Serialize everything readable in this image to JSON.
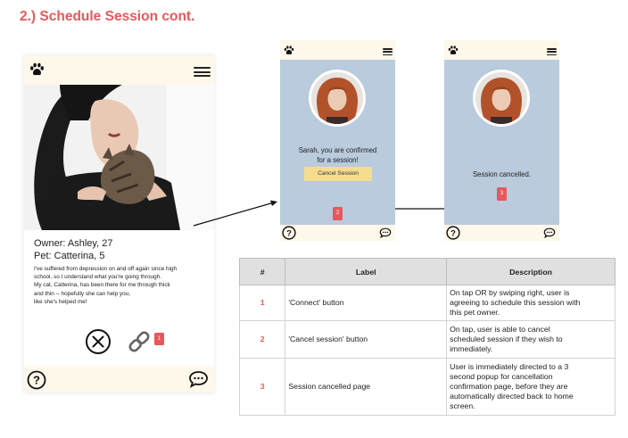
{
  "title": "2.) Schedule Session cont.",
  "screen1": {
    "owner": "Owner: Ashley, 27",
    "pet": "Pet: Catterina, 5",
    "bio_lines": [
      "I've suffered from depression on and off again since high",
      "school, so I understand what you're going through.",
      "My cat, Catterina, has been there for me through thick",
      "and thin -- hopefully she can help you,",
      "like she's helped me!"
    ],
    "badge": "1"
  },
  "screen2": {
    "message_line1": "Sarah, you are confirmed",
    "message_line2": "for a session!",
    "cancel_button": "Cancel Session",
    "badge": "2"
  },
  "screen3": {
    "message": "Session cancelled.",
    "badge": "3"
  },
  "table": {
    "headers": [
      "#",
      "Label",
      "Description"
    ],
    "rows": [
      {
        "num": "1",
        "label": "'Connect' button",
        "desc": [
          "On tap OR by swiping right, user is",
          "agreeing to schedule this session with",
          "this pet owner."
        ]
      },
      {
        "num": "2",
        "label": "'Cancel session' button",
        "desc": [
          "On tap, user is able to cancel",
          "scheduled session if they wish to",
          "immediately."
        ]
      },
      {
        "num": "3",
        "label": "Session cancelled page",
        "desc": [
          "User is immediately directed to a 3",
          "second popup for cancellation",
          "confirmation page, before they are",
          "automatically directed back to home",
          "screen."
        ]
      }
    ]
  },
  "colors": {
    "accent": "#e8585a",
    "bar_bg": "#fdf8ea",
    "phone_bg": "#b9cbdc",
    "cancel_button_bg": "#f5dc8f"
  },
  "icons": [
    "paw-icon",
    "hamburger-menu-icon",
    "help-icon",
    "chat-bubble-icon",
    "close-circle-icon",
    "link-icon",
    "arrow-icon"
  ]
}
